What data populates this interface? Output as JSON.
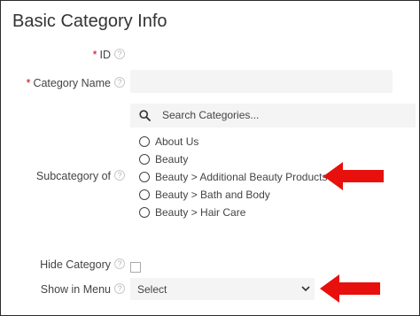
{
  "title": "Basic Category Info",
  "fields": {
    "id_label": "ID",
    "category_name_label": "Category Name",
    "subcategory_label": "Subcategory of",
    "hide_category_label": "Hide Category",
    "show_in_menu_label": "Show in Menu",
    "required_mark": "*",
    "help_glyph": "?"
  },
  "search": {
    "placeholder": "Search Categories..."
  },
  "subcategory_options": [
    "About Us",
    "Beauty",
    "Beauty > Additional Beauty Products",
    "Beauty > Bath and Body",
    "Beauty > Hair Care"
  ],
  "show_in_menu": {
    "selected": "Select"
  },
  "colors": {
    "arrow": "#e8100c",
    "field_bg": "#f4f4f4",
    "required": "#d0021b"
  }
}
